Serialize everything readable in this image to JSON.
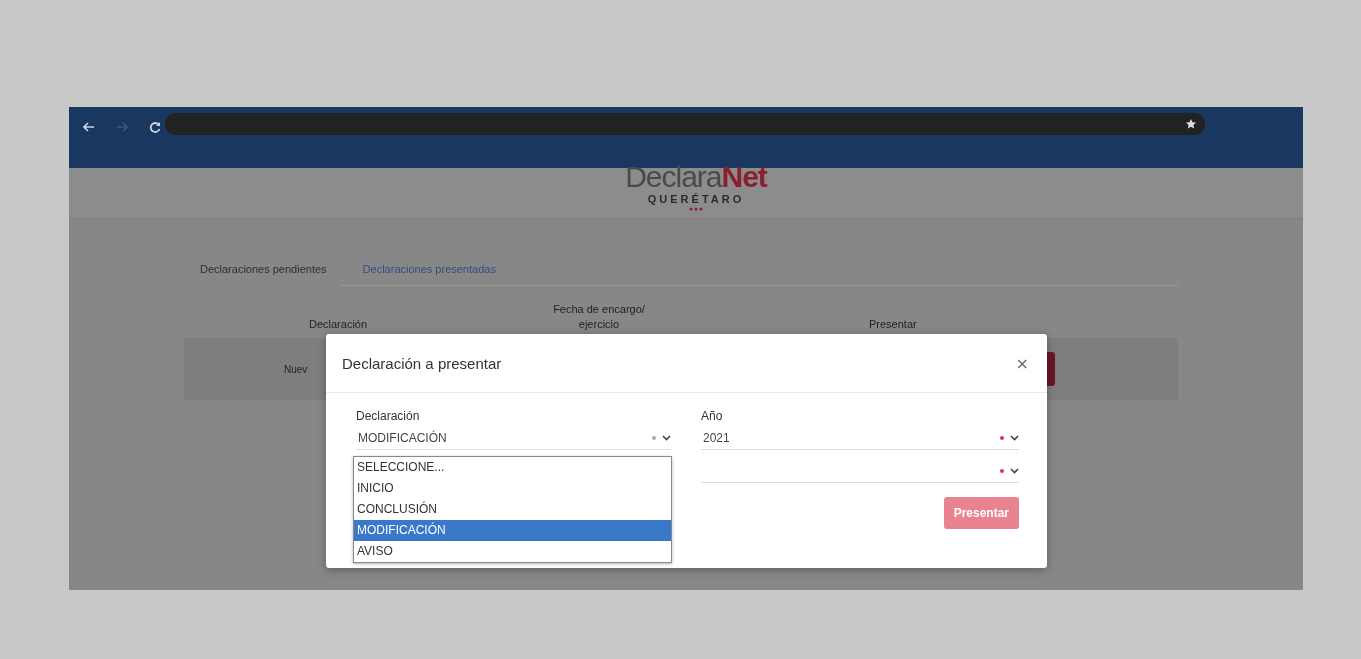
{
  "browser": {
    "nav_buttons": [
      {
        "kind": "back",
        "disabled": false
      },
      {
        "kind": "forward",
        "disabled": true
      },
      {
        "kind": "reload",
        "disabled": false
      }
    ]
  },
  "logo": {
    "word_main": "Declara",
    "word_accent": "Net",
    "subtitle": "QUERÉTARO"
  },
  "tabs": [
    {
      "label": "Declaraciones pendientes",
      "selected": false
    },
    {
      "label": "Declaraciones presentadas",
      "selected": true
    }
  ],
  "table": {
    "columns": [
      "Declaración",
      "Fecha de encargo/ ejercicio",
      "Presentar"
    ],
    "rows": [
      {
        "column_1": "Nuev"
      }
    ]
  },
  "modal": {
    "title": "Declaración a presentar",
    "close": "×",
    "fields": [
      {
        "label": "Declaración",
        "value": "MODIFICACIÓN",
        "required": true,
        "highlighted": false
      },
      {
        "label": "Año",
        "value": "2021",
        "required": true,
        "highlighted": true
      },
      {
        "required": true,
        "highlighted": true
      }
    ],
    "dropdown": {
      "options": [
        {
          "label": "SELECCIONE...",
          "selected": false
        },
        {
          "label": "INICIO",
          "selected": false
        },
        {
          "label": "CONCLUSIÓN",
          "selected": false
        },
        {
          "label": "MODIFICACIÓN",
          "selected": true
        },
        {
          "label": "AVISO",
          "selected": false
        }
      ]
    },
    "submit": {
      "label": "Presentar",
      "disabled": true
    }
  }
}
